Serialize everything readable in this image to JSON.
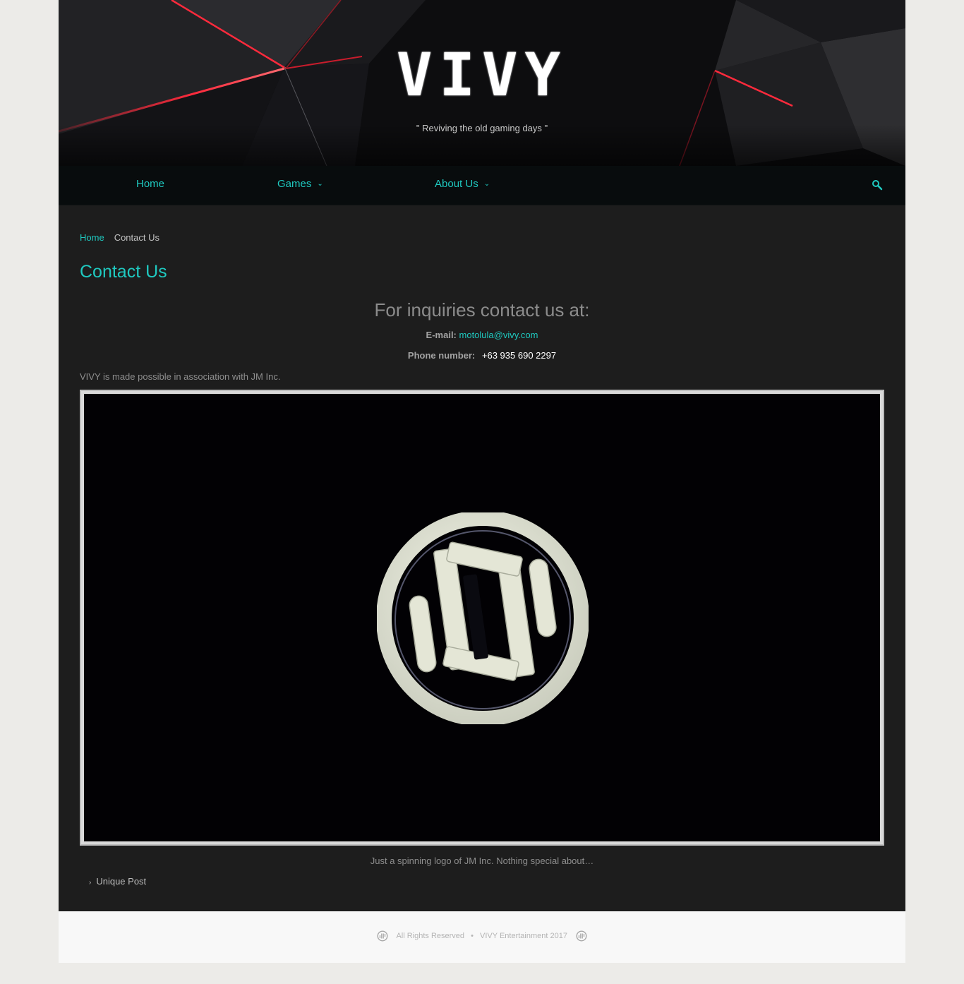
{
  "header": {
    "site_title": "VIVY",
    "tagline": "\" Reviving the old gaming days \""
  },
  "nav": {
    "home": "Home",
    "games": "Games",
    "about": "About Us",
    "search_icon": "search-icon"
  },
  "breadcrumb": {
    "home": "Home",
    "current": "Contact Us"
  },
  "page": {
    "title": "Contact Us",
    "inquiry_heading": "For inquiries contact us at:",
    "email_label": "E-mail:",
    "email": "motolula@vivy.com",
    "phone_label": "Phone number:",
    "phone": "+63 935 690 2297",
    "association": "VIVY is made possible in association with JM Inc.",
    "media_caption": "Just a spinning logo of JM Inc.  Nothing special about…",
    "post_link": "Unique Post"
  },
  "footer": {
    "rights": "All Rights Reserved",
    "separator": "•",
    "company": "VIVY Entertainment 2017"
  },
  "colors": {
    "accent": "#1fc9c0",
    "content_bg": "#1d1d1d",
    "nav_bg": "#080c0d",
    "page_bg": "#ecebe8"
  }
}
